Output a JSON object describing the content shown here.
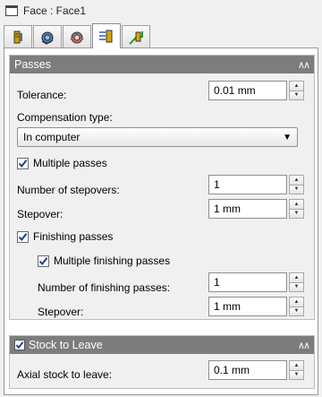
{
  "window": {
    "title": "Face : Face1",
    "title_icon": "window-icon"
  },
  "tabs": [
    {
      "icon": "tool-tab-icon",
      "active": false
    },
    {
      "icon": "holder-tab-icon",
      "active": false
    },
    {
      "icon": "geometry-tab-icon",
      "active": false
    },
    {
      "icon": "heights-tab-icon",
      "active": true
    },
    {
      "icon": "passes-tab-icon",
      "active": false
    }
  ],
  "passes_section": {
    "title": "Passes",
    "collapse_icon": "double-chevron-up-icon",
    "tolerance": {
      "label": "Tolerance:",
      "value": "0.01 mm"
    },
    "compensation": {
      "label": "Compensation type:",
      "selected": "In computer"
    },
    "multiple_passes": {
      "label": "Multiple passes",
      "checked": true
    },
    "num_stepovers": {
      "label": "Number of stepovers:",
      "value": "1"
    },
    "stepover": {
      "label": "Stepover:",
      "value": "1 mm"
    },
    "finishing_passes": {
      "label": "Finishing passes",
      "checked": true
    },
    "multiple_finishing": {
      "label": "Multiple finishing passes",
      "checked": true
    },
    "num_finishing": {
      "label": "Number of finishing passes:",
      "value": "1"
    },
    "finishing_stepover": {
      "label": "Stepover:",
      "value": "1 mm"
    }
  },
  "stock_section": {
    "title": "Stock to Leave",
    "checked": true,
    "collapse_icon": "double-chevron-up-icon",
    "axial": {
      "label": "Axial stock to leave:",
      "value": "0.1 mm"
    }
  }
}
